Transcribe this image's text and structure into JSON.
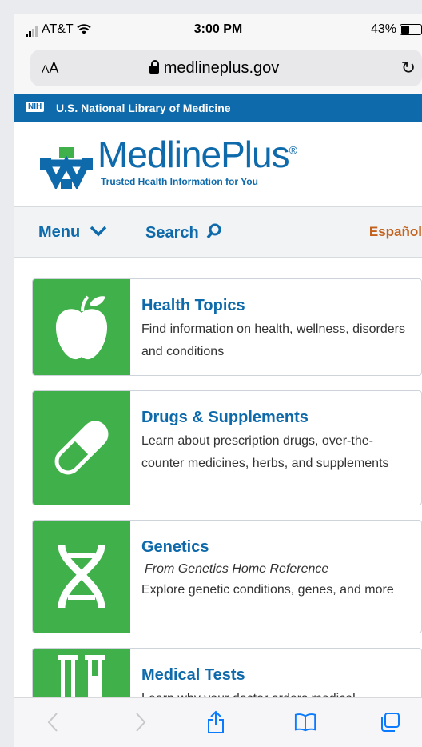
{
  "status_bar": {
    "carrier": "AT&T",
    "time": "3:00 PM",
    "battery": "43%"
  },
  "url_bar": {
    "text_size_label_small": "A",
    "text_size_label_large": "A",
    "domain": "medlineplus.gov"
  },
  "nih_bar": {
    "badge": "NIH",
    "label": "U.S. National Library of Medicine"
  },
  "logo": {
    "brand": "MedlinePlus",
    "registered": "®",
    "tagline": "Trusted Health Information for You"
  },
  "nav": {
    "menu_label": "Menu",
    "search_label": "Search",
    "language_label": "Español"
  },
  "cards": [
    {
      "title": "Health Topics",
      "description": "Find information on health, wellness, disorders and conditions",
      "icon": "apple-icon"
    },
    {
      "title": "Drugs & Supplements",
      "description": "Learn about prescription drugs, over-the-counter medicines, herbs, and supplements",
      "icon": "pill-icon"
    },
    {
      "title": "Genetics",
      "source": "From Genetics Home Reference",
      "description": "Explore genetic conditions, genes, and more",
      "icon": "dna-icon"
    },
    {
      "title": "Medical Tests",
      "description": "Learn why your doctor orders medical",
      "icon": "test-tubes-icon"
    }
  ],
  "colors": {
    "brand_blue": "#0e6aab",
    "tile_green": "#40b04a",
    "spanish_orange": "#c3611c"
  }
}
